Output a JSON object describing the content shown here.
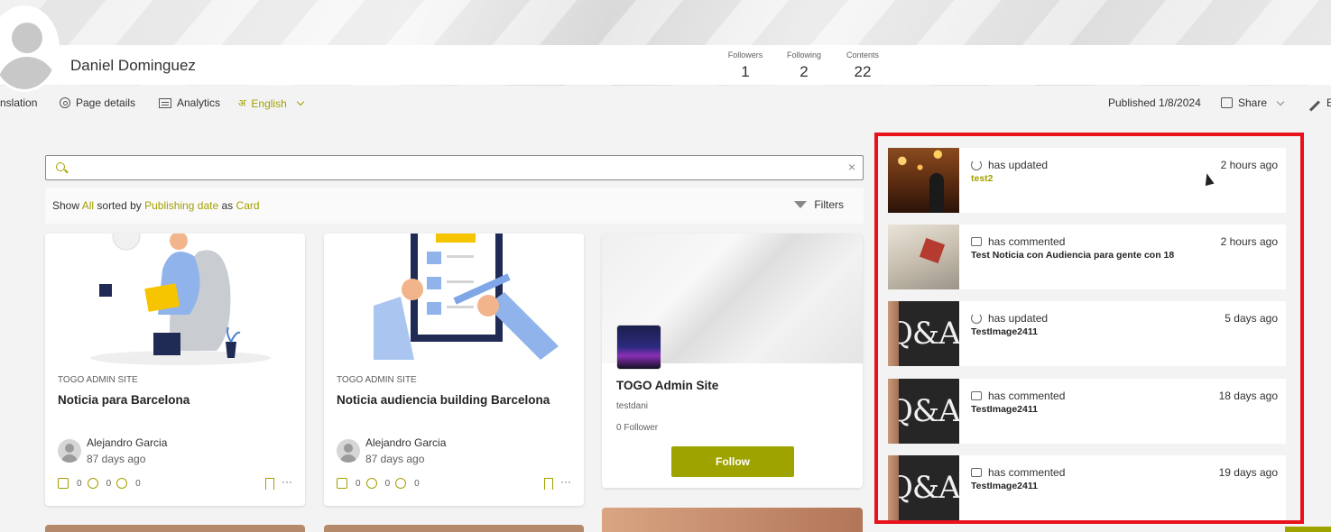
{
  "profile": {
    "name": "Daniel Dominguez",
    "stats": [
      {
        "label": "Followers",
        "value": "1"
      },
      {
        "label": "Following",
        "value": "2"
      },
      {
        "label": "Contents",
        "value": "22"
      }
    ]
  },
  "toolbar": {
    "translation": "nslation",
    "page_details": "Page details",
    "analytics": "Analytics",
    "language": "English",
    "published": "Published 1/8/2024",
    "share": "Share",
    "edit_partial": "E"
  },
  "search": {
    "placeholder": "",
    "value": "",
    "clear": "×"
  },
  "filter": {
    "show": "Show",
    "all": "All",
    "sorted_by": "sorted by",
    "sort": "Publishing date",
    "as": "as",
    "view": "Card",
    "filters_label": "Filters"
  },
  "cards": [
    {
      "site": "TOGO ADMIN SITE",
      "title": "Noticia para Barcelona",
      "author": "Alejandro Garcia",
      "age": "87 days ago",
      "likes": "0",
      "comments": "0",
      "views": "0"
    },
    {
      "site": "TOGO ADMIN SITE",
      "title": "Noticia audiencia building Barcelona",
      "author": "Alejandro Garcia",
      "age": "87 days ago",
      "likes": "0",
      "comments": "0",
      "views": "0"
    }
  ],
  "site_card": {
    "title": "TOGO Admin Site",
    "owner": "testdani",
    "followers": "0",
    "followers_label": "Follower",
    "follow_label": "Follow"
  },
  "activity": [
    {
      "verb": "has updated",
      "target": "test2",
      "when": "2 hours ago",
      "icon": "refresh-icon",
      "thumb": "carousel-photo",
      "accent": true
    },
    {
      "verb": "has commented",
      "target": "Test Noticia con Audiencia para gente con 18",
      "when": "2 hours ago",
      "icon": "comment-icon",
      "thumb": "house-photo",
      "accent": false
    },
    {
      "verb": "has updated",
      "target": "TestImage2411",
      "when": "5 days ago",
      "icon": "refresh-icon",
      "thumb": "qa-photo",
      "accent": false
    },
    {
      "verb": "has commented",
      "target": "TestImage2411",
      "when": "18 days ago",
      "icon": "comment-icon",
      "thumb": "qa-photo",
      "accent": false
    },
    {
      "verb": "has commented",
      "target": "TestImage2411",
      "when": "19 days ago",
      "icon": "comment-icon",
      "thumb": "qa-photo",
      "accent": false
    }
  ],
  "qa_text": "Q&A",
  "colors": {
    "accent": "#a4a000",
    "follow_button": "#9ea300",
    "highlight_border": "#e8121c"
  }
}
